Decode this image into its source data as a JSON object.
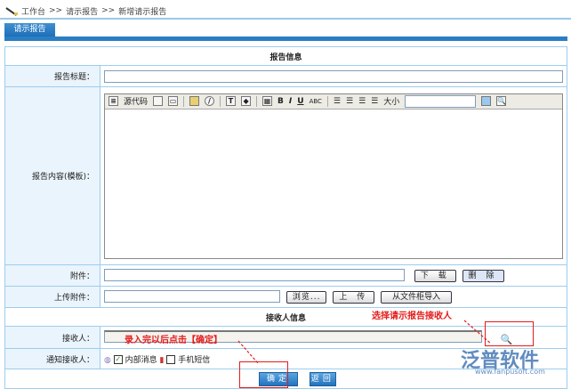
{
  "breadcrumb": [
    "工作台",
    ">>",
    "请示报告",
    ">>",
    "新增请示报告"
  ],
  "tab": "请示报告",
  "sections": {
    "report_info": "报告信息",
    "receiver_info": "接收人信息"
  },
  "fields": {
    "title_label": "报告标题：",
    "title_value": "",
    "content_label": "报告内容(模板)：",
    "attachment_label": "附件：",
    "download": "下 载",
    "delete": "删 除",
    "upload_label": "上传附件：",
    "browse": "浏览...",
    "upload": "上 传",
    "import": "从文件柜导入",
    "receiver_label": "接收人：",
    "receiver_value": "",
    "notify_label": "通知接收人：",
    "internal_msg": "内部消息",
    "internal_checked": true,
    "sms": "手机短信",
    "sms_checked": false
  },
  "editor": {
    "source": "源代码",
    "size": "大小",
    "size_value": ""
  },
  "buttons": {
    "ok": "确定",
    "back": "返回"
  },
  "annotations": {
    "choose": "选择请示报告接收人",
    "confirm": "录入完以后点击【确定】"
  },
  "watermark": {
    "name": "泛普软件",
    "url": "www.fanpusoft.com"
  },
  "colors": {
    "accent": "#2a7ec4",
    "annotation": "#e41b1b"
  }
}
